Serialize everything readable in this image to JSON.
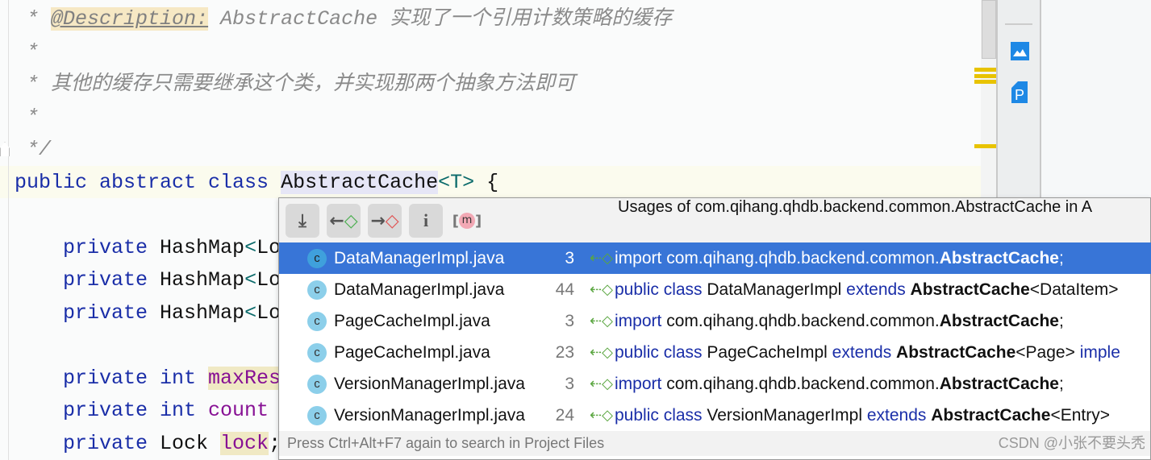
{
  "editor": {
    "lines": [
      [
        {
          "t": " * ",
          "c": "cm"
        },
        {
          "t": "@Description:",
          "c": "tag"
        },
        {
          "t": " AbstractCache 实现了一个引用计数策略的缓存",
          "c": "cm"
        }
      ],
      [
        {
          "t": " *",
          "c": "cm"
        }
      ],
      [
        {
          "t": " * 其他的缓存只需要继承这个类，并实现那两个抽象方法即可",
          "c": "cm"
        }
      ],
      [
        {
          "t": " *",
          "c": "cm"
        }
      ],
      [
        {
          "t": " */",
          "c": "cm"
        }
      ],
      [
        {
          "t": "public abstract class ",
          "c": "kw"
        },
        {
          "t": "AbstractCache",
          "c": "sel"
        },
        {
          "t": "<T>",
          "c": "typ"
        },
        {
          "t": " {",
          "c": ""
        }
      ],
      [],
      [
        {
          "t": "    private ",
          "c": "kw"
        },
        {
          "t": "HashMap",
          "c": ""
        },
        {
          "t": "<",
          "c": "typ"
        },
        {
          "t": "Lo",
          "c": ""
        }
      ],
      [
        {
          "t": "    private ",
          "c": "kw"
        },
        {
          "t": "HashMap",
          "c": ""
        },
        {
          "t": "<",
          "c": "typ"
        },
        {
          "t": "Lo",
          "c": ""
        }
      ],
      [
        {
          "t": "    private ",
          "c": "kw"
        },
        {
          "t": "HashMap",
          "c": ""
        },
        {
          "t": "<",
          "c": "typ"
        },
        {
          "t": "Lo",
          "c": ""
        }
      ],
      [],
      [
        {
          "t": "    private int ",
          "c": "kw"
        },
        {
          "t": "maxRes",
          "c": "fld hl"
        }
      ],
      [
        {
          "t": "    private int ",
          "c": "kw"
        },
        {
          "t": "count",
          "c": "fld"
        }
      ],
      [
        {
          "t": "    private ",
          "c": "kw"
        },
        {
          "t": "Lock ",
          "c": ""
        },
        {
          "t": "lock",
          "c": "fld hl"
        },
        {
          "t": ";",
          "c": ""
        }
      ]
    ]
  },
  "popup": {
    "toolbar": {
      "pin": "pin-icon",
      "prev": "previous-usage-icon",
      "next": "next-usage-icon",
      "info": "info-icon",
      "method": "m"
    },
    "title": "Usages of com.qihang.qhdb.backend.common.AbstractCache in A",
    "rows": [
      {
        "file": "DataManagerImpl.java",
        "line": "3",
        "parts": [
          [
            "k",
            "import "
          ],
          [
            "",
            "com.qihang.qhdb.backend.common."
          ],
          [
            "b",
            "AbstractCache"
          ],
          [
            "",
            ";"
          ]
        ]
      },
      {
        "file": "DataManagerImpl.java",
        "line": "44",
        "parts": [
          [
            "k",
            "public class "
          ],
          [
            "",
            "DataManagerImpl "
          ],
          [
            "k",
            "extends "
          ],
          [
            "b",
            "AbstractCache"
          ],
          [
            "",
            "<DataItem>"
          ]
        ]
      },
      {
        "file": "PageCacheImpl.java",
        "line": "3",
        "parts": [
          [
            "k",
            "import "
          ],
          [
            "",
            "com.qihang.qhdb.backend.common."
          ],
          [
            "b",
            "AbstractCache"
          ],
          [
            "",
            ";"
          ]
        ]
      },
      {
        "file": "PageCacheImpl.java",
        "line": "23",
        "parts": [
          [
            "k",
            "public class "
          ],
          [
            "",
            "PageCacheImpl "
          ],
          [
            "k",
            "extends "
          ],
          [
            "b",
            "AbstractCache"
          ],
          [
            "",
            "<Page> "
          ],
          [
            "k",
            "imple"
          ]
        ]
      },
      {
        "file": "VersionManagerImpl.java",
        "line": "3",
        "parts": [
          [
            "k",
            "import "
          ],
          [
            "",
            "com.qihang.qhdb.backend.common."
          ],
          [
            "b",
            "AbstractCache"
          ],
          [
            "",
            ";"
          ]
        ]
      },
      {
        "file": "VersionManagerImpl.java",
        "line": "24",
        "parts": [
          [
            "k",
            "public class "
          ],
          [
            "",
            "VersionManagerImpl "
          ],
          [
            "k",
            "extends "
          ],
          [
            "b",
            "AbstractCache"
          ],
          [
            "",
            "<Entry>"
          ]
        ]
      }
    ],
    "footer": "Press Ctrl+Alt+F7 again to search in Project Files",
    "watermark": "CSDN @小张不要头秃"
  }
}
